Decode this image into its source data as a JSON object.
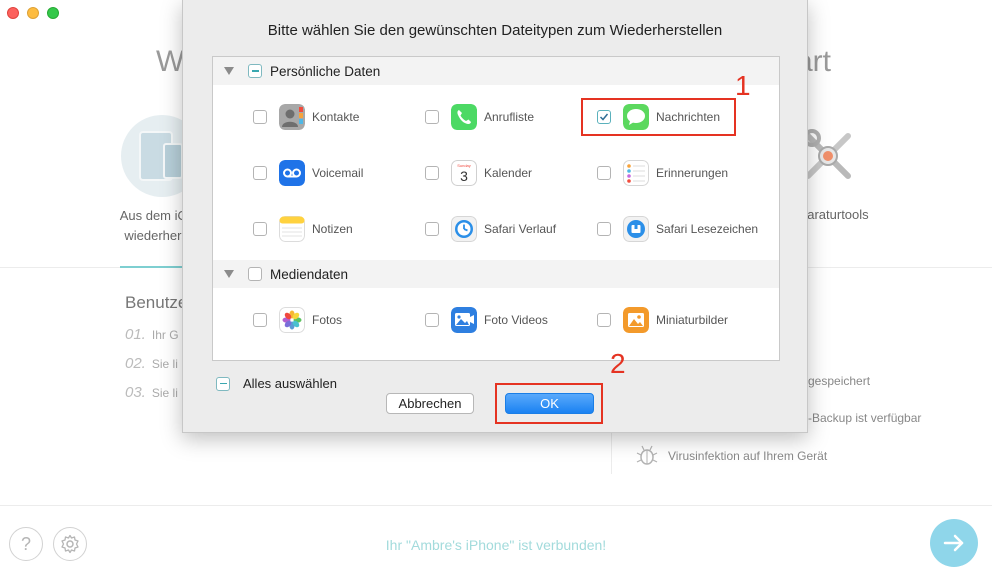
{
  "window": {
    "traffic_lights": [
      "close",
      "minimize",
      "zoom"
    ]
  },
  "background": {
    "title_left_fragment": "W",
    "title_right_fragment": "art",
    "mode_ios": {
      "label_line1": "Aus dem iOS",
      "label_line2": "wiederherst",
      "icon": "ipad-iphone-icon"
    },
    "mode_tools": {
      "label": "paraturtools",
      "icon": "wrench-screwdriver-icon"
    },
    "steps_title": "Benutze",
    "steps": [
      {
        "num": "01.",
        "text": "Ihr G"
      },
      {
        "num": "02.",
        "text": "Sie li"
      },
      {
        "num": "03.",
        "text": "Sie li"
      }
    ],
    "features": {
      "f1": "gespeichert",
      "f2": "-Backup ist verfügbar",
      "f3": "Virusinfektion auf Ihrem Gerät"
    },
    "footer": {
      "help_symbol": "?",
      "status": "Ihr \"Ambre's iPhone\" ist verbunden!"
    },
    "colors": {
      "accent": "#7ecfd1",
      "next_button": "#8fd6ea"
    }
  },
  "dialog": {
    "title": "Bitte wählen Sie den gewünschten Dateitypen zum Wiederherstellen",
    "sections": [
      {
        "label": "Persönliche Daten",
        "state": "mixed",
        "items": [
          {
            "label": "Kontakte",
            "icon": "contacts-icon",
            "checked": false
          },
          {
            "label": "Anrufliste",
            "icon": "phone-icon",
            "checked": false
          },
          {
            "label": "Nachrichten",
            "icon": "messages-icon",
            "checked": true
          },
          {
            "label": "Voicemail",
            "icon": "voicemail-icon",
            "checked": false
          },
          {
            "label": "Kalender",
            "icon": "calendar-icon",
            "checked": false,
            "icon_day": "3",
            "icon_weekday": "Sunday"
          },
          {
            "label": "Erinnerungen",
            "icon": "reminders-icon",
            "checked": false
          },
          {
            "label": "Notizen",
            "icon": "notes-icon",
            "checked": false
          },
          {
            "label": "Safari Verlauf",
            "icon": "safari-history-icon",
            "checked": false
          },
          {
            "label": "Safari Lesezeichen",
            "icon": "safari-bookmarks-icon",
            "checked": false
          }
        ]
      },
      {
        "label": "Mediendaten",
        "state": "unchecked",
        "items": [
          {
            "label": "Fotos",
            "icon": "photos-icon",
            "checked": false
          },
          {
            "label": "Foto Videos",
            "icon": "photo-videos-icon",
            "checked": false
          },
          {
            "label": "Miniaturbilder",
            "icon": "thumbnails-icon",
            "checked": false
          }
        ]
      }
    ],
    "select_all": {
      "label": "Alles auswählen",
      "state": "mixed"
    },
    "buttons": {
      "cancel": "Abbrechen",
      "ok": "OK"
    }
  },
  "annotations": {
    "marker1": "1",
    "marker2": "2",
    "color": "#e53322"
  }
}
